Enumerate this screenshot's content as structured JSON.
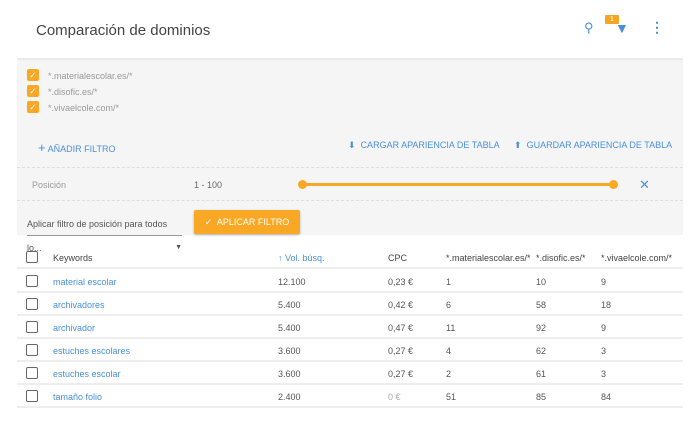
{
  "header": {
    "title": "Comparación de dominios",
    "filter_badge": "1",
    "icons": [
      "search-icon",
      "filter-icon",
      "more-vert-icon"
    ]
  },
  "domains": [
    "*.materialescolar.es/*",
    "*.disofic.es/*",
    "*.vivaelcole.com/*"
  ],
  "actions": {
    "add_filter": "AÑADIR FILTRO",
    "load_layout": "CARGAR APARIENCIA DE TABLA",
    "save_layout": "GUARDAR APARIENCIA DE TABLA"
  },
  "position_filter": {
    "label": "Posición",
    "range": "1 - 100",
    "min": 1,
    "max": 100
  },
  "apply_row": {
    "select_value": "Aplicar filtro de posición para todos lo...",
    "apply_label": "APLICAR FILTRO"
  },
  "colors": {
    "accent": "#f9a825",
    "link": "#4a90d9"
  },
  "table": {
    "headers": [
      "Keywords",
      "↑ Vol. búsq.",
      "CPC",
      "*.materialescolar.es/*",
      "*.disofic.es/*",
      "*.vivaelcole.com/*"
    ],
    "rows": [
      [
        "material escolar",
        "12.100",
        "0,23 €",
        "1",
        "10",
        "9"
      ],
      [
        "archivadores",
        "5.400",
        "0,42 €",
        "6",
        "58",
        "18"
      ],
      [
        "archivador",
        "5.400",
        "0,47 €",
        "11",
        "92",
        "9"
      ],
      [
        "estuches escolares",
        "3.600",
        "0,27 €",
        "4",
        "62",
        "3"
      ],
      [
        "estuches escolar",
        "3.600",
        "0,27 €",
        "2",
        "61",
        "3"
      ],
      [
        "tamaño folio",
        "2.400",
        "0 €",
        "51",
        "85",
        "84"
      ]
    ]
  }
}
